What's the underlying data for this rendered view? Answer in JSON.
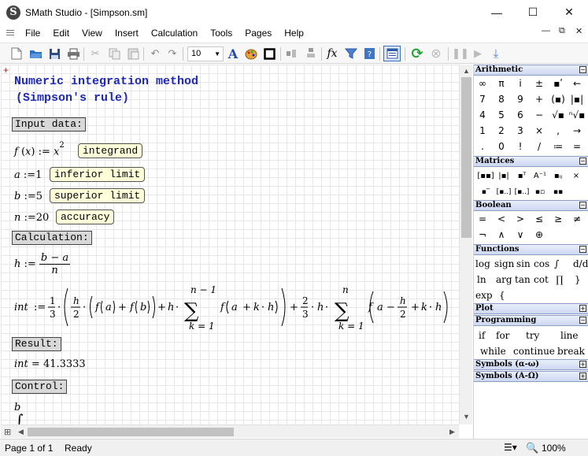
{
  "window": {
    "title": "SMath Studio - [Simpson.sm]",
    "app_icon_letter": "S",
    "minimize": "—",
    "maximize": "☐",
    "close": "✕"
  },
  "menu": {
    "items": [
      "File",
      "Edit",
      "View",
      "Insert",
      "Calculation",
      "Tools",
      "Pages",
      "Help"
    ],
    "mdi_minimize": "—",
    "mdi_restore": "⧉",
    "mdi_close": "✕"
  },
  "toolbar": {
    "font_size": "10"
  },
  "worksheet": {
    "heading_line1": "Numeric integration method",
    "heading_line2": "(Simpson's rule)",
    "label_input": "Input data:",
    "label_calculation": "Calculation:",
    "label_result": "Result:",
    "label_control": "Control:",
    "note_integrand": "integrand",
    "note_inferior": "inferior limit",
    "note_superior": "superior limit",
    "note_accuracy": "accuracy",
    "f_def": {
      "name": "f",
      "arg": "x",
      "body_base": "x",
      "body_exp": "2"
    },
    "a_def": {
      "name": "a",
      "value": "1"
    },
    "b_def": {
      "name": "b",
      "value": "5"
    },
    "n_def": {
      "name": "n",
      "value": "20"
    },
    "h_def": {
      "name": "h",
      "num": "b − a",
      "den": "n"
    },
    "int_def": {
      "name": "int",
      "sum_top": "n − 1",
      "sum_bottom": "k = 1",
      "sum2_top": "n",
      "sum2_bottom": "k = 1"
    },
    "result": {
      "name": "int",
      "value": "41.3333"
    },
    "control_upper": "b"
  },
  "panel": {
    "arithmetic": {
      "title": "Arithmetic",
      "rows": [
        [
          "∞",
          "π",
          "i",
          "±",
          "▪ʹ",
          "←"
        ],
        [
          "7",
          "8",
          "9",
          "+",
          "(▪)",
          "|▪|"
        ],
        [
          "4",
          "5",
          "6",
          "−",
          "√▪",
          "ⁿ√▪"
        ],
        [
          "1",
          "2",
          "3",
          "×",
          ",",
          "→"
        ],
        [
          ".",
          "0",
          "!",
          "/",
          "≔",
          "="
        ]
      ]
    },
    "matrices": {
      "title": "Matrices"
    },
    "boolean": {
      "title": "Boolean",
      "rows": [
        [
          "=",
          "<",
          ">",
          "≤",
          "≥",
          "≠"
        ],
        [
          "¬",
          "∧",
          "∨",
          "⊕"
        ]
      ]
    },
    "functions": {
      "title": "Functions",
      "row1": [
        "log",
        "sign",
        "sin",
        "cos"
      ],
      "row2": [
        "ln",
        "arg",
        "tan",
        "cot"
      ],
      "row3": [
        "exp"
      ]
    },
    "plot": {
      "title": "Plot"
    },
    "programming": {
      "title": "Programming",
      "row1": [
        "if",
        "for",
        "try",
        "line"
      ],
      "row2": [
        "while",
        "continue",
        "break"
      ]
    },
    "symbols_greek_lower": {
      "title": "Symbols (α-ω)"
    },
    "symbols_greek_upper": {
      "title": "Symbols (Α-Ω)"
    },
    "toggle_minus": "−",
    "toggle_plus": "+"
  },
  "status": {
    "page": "Page 1 of 1",
    "state": "Ready",
    "zoom": "100%"
  }
}
